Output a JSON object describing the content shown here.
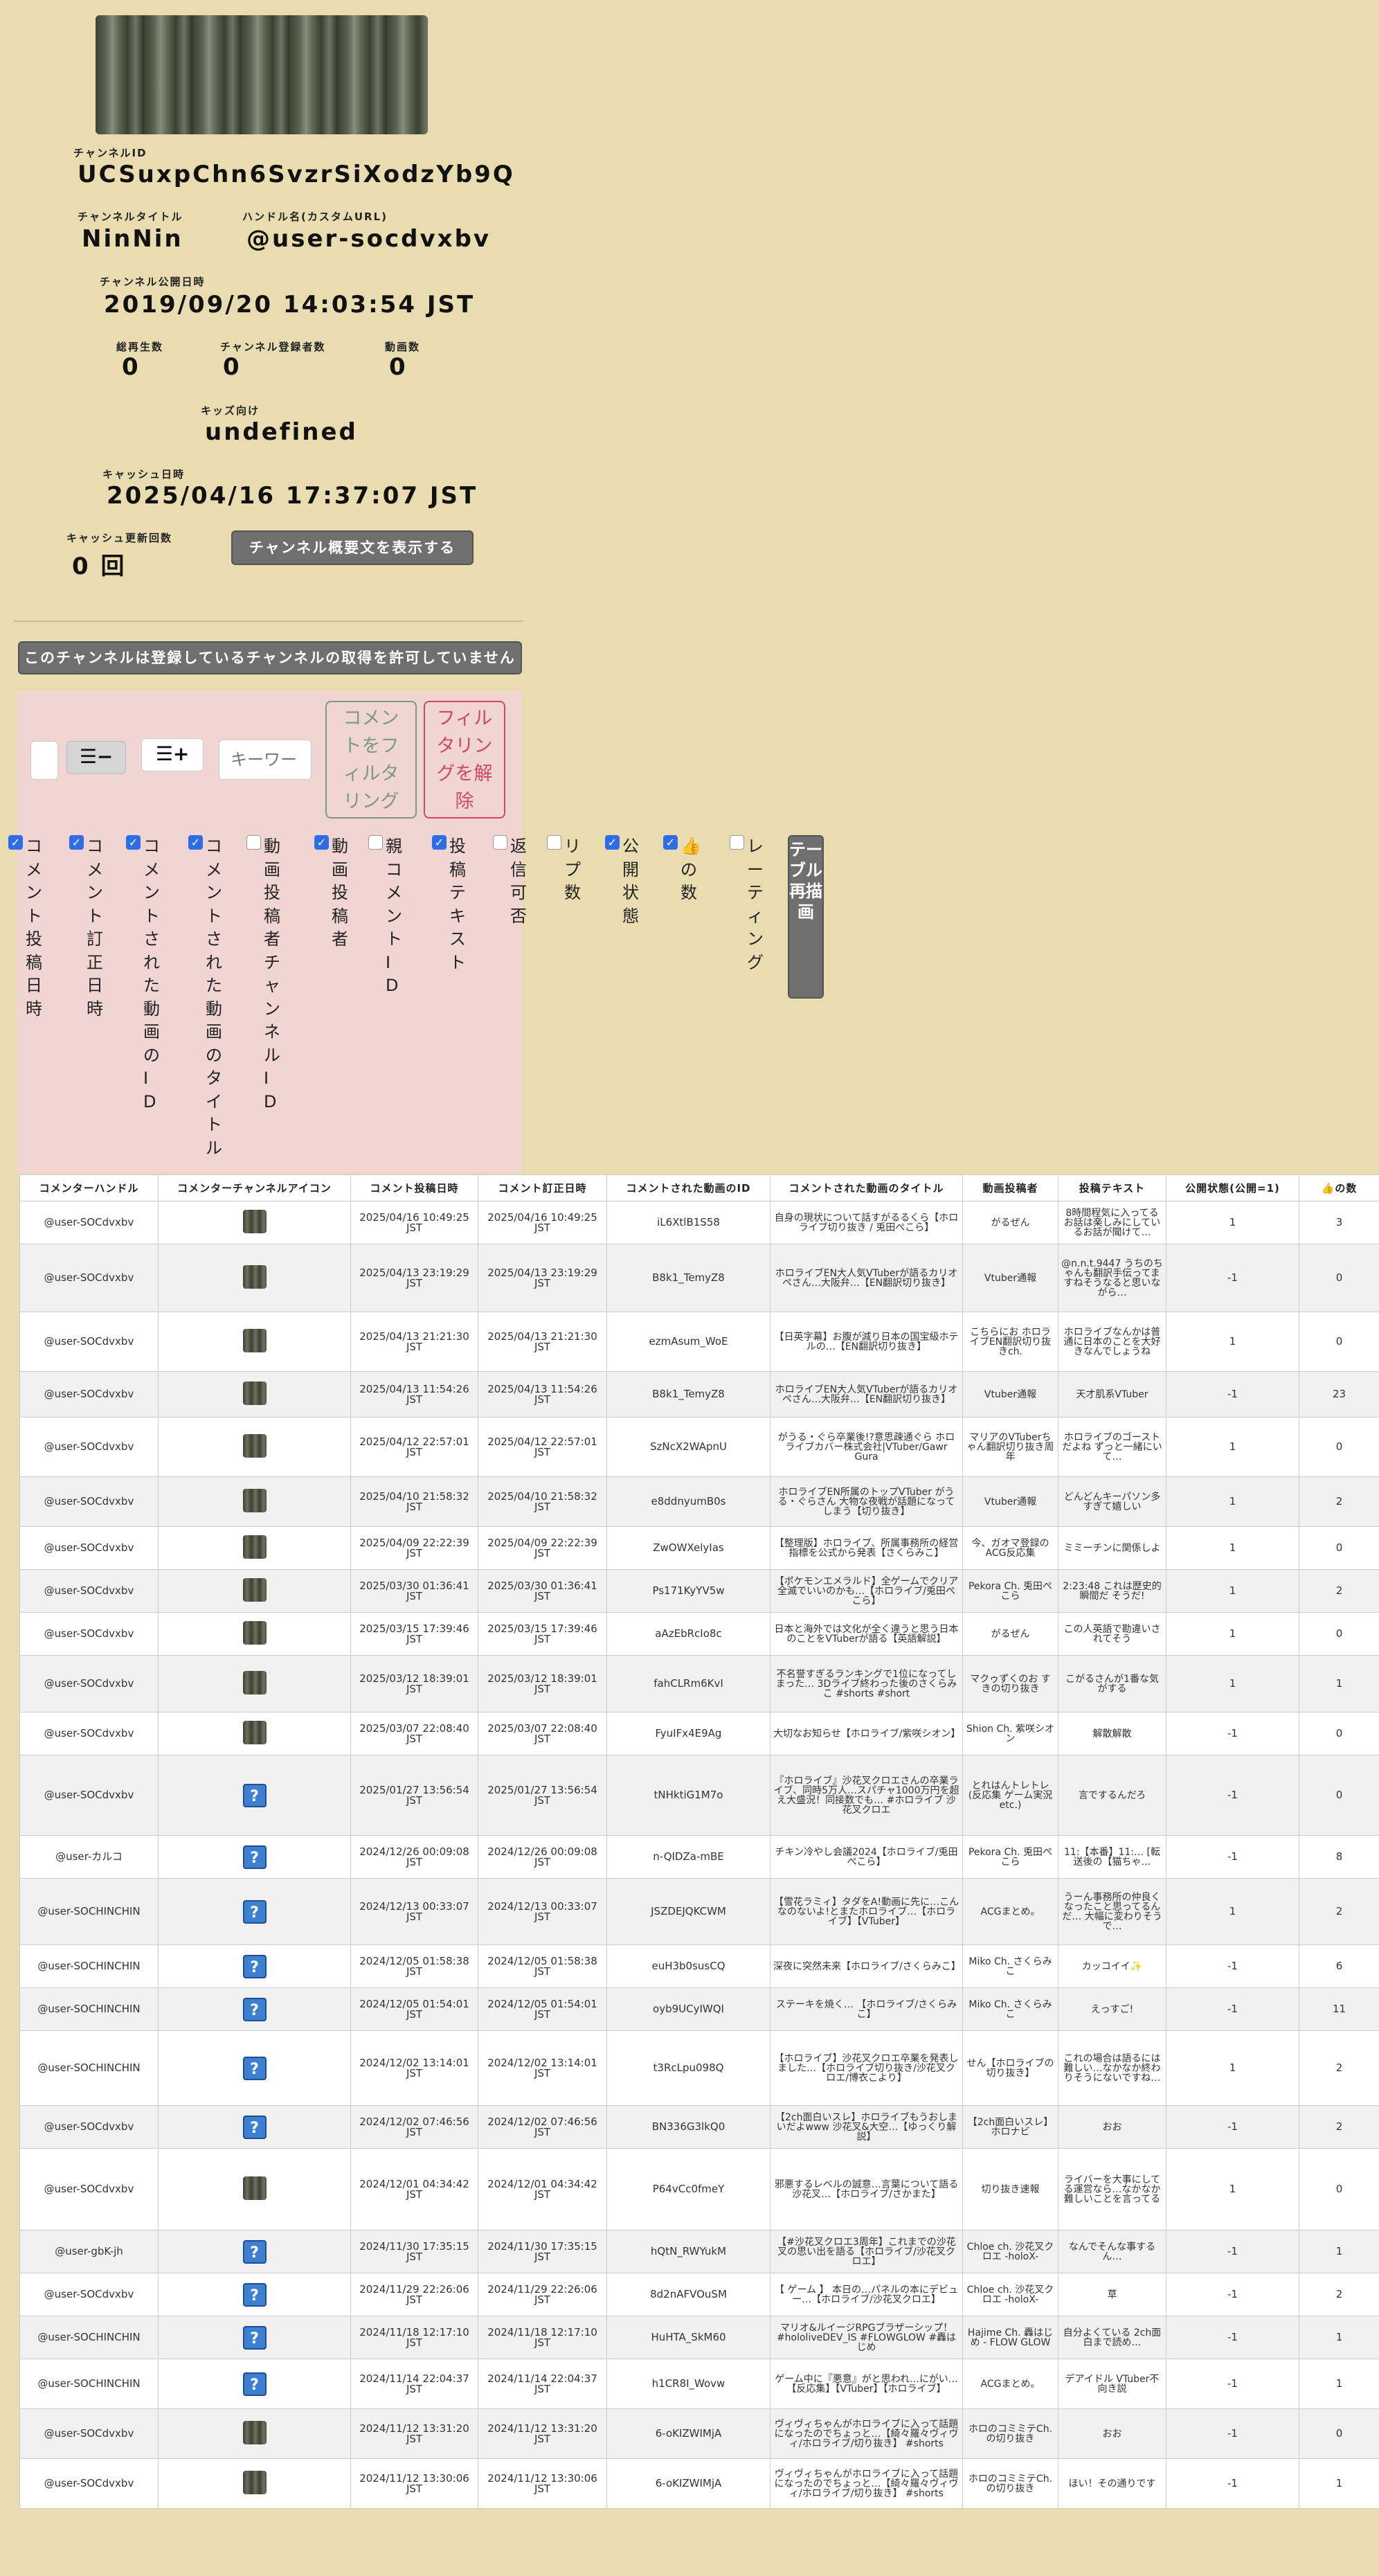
{
  "channel": {
    "id_label": "チャンネルID",
    "id": "UCSuxpChn6SvzrSiXodzYb9Q",
    "title_label": "チャンネルタイトル",
    "title": "NinNin",
    "handle_label": "ハンドル名(カスタムURL)",
    "handle": "@user-socdvxbv",
    "published_label": "チャンネル公開日時",
    "published": "2019/09/20 14:03:54 JST",
    "views_label": "総再生数",
    "views": "0",
    "subs_label": "チャンネル登録者数",
    "subs": "0",
    "videos_label": "動画数",
    "videos": "0",
    "kids_label": "キッズ向け",
    "kids": "undefined",
    "cache_label": "キャッシュ日時",
    "cache": "2025/04/16 17:37:07 JST",
    "refresh_label": "キャッシュ更新回数",
    "refresh": "0 回",
    "desc_button": "チャンネル概要文を表示する",
    "notice": "このチャンネルは登録しているチャンネルの取得を許可していません"
  },
  "filter": {
    "keyword_placeholder": "キーワー",
    "filter_button": "コメントをフィルタリング",
    "clear_button": "フィルタリングを解除",
    "redraw_button": "テーブル再描画",
    "columns": [
      {
        "label": "コメント投稿日時",
        "checked": true
      },
      {
        "label": "コメント訂正日時",
        "checked": true
      },
      {
        "label": "コメントされた動画のID",
        "checked": true
      },
      {
        "label": "コメントされた動画のタイトル",
        "checked": true
      },
      {
        "label": "動画投稿者チャンネルID",
        "checked": false
      },
      {
        "label": "動画投稿者",
        "checked": true
      },
      {
        "label": "親コメントID",
        "checked": false
      },
      {
        "label": "投稿テキスト",
        "checked": true
      },
      {
        "label": "返信可否",
        "checked": false
      },
      {
        "label": "リプ数",
        "checked": false
      },
      {
        "label": "公開状態",
        "checked": true
      },
      {
        "label": "👍の数",
        "checked": true
      },
      {
        "label": "レーティング",
        "checked": false
      }
    ]
  },
  "table": {
    "headers": [
      "コメンターハンドル",
      "コメンターチャンネルアイコン",
      "コメント投稿日時",
      "コメント訂正日時",
      "コメントされた動画のID",
      "コメントされた動画のタイトル",
      "動画投稿者",
      "投稿テキスト",
      "公開状態(公開=1)",
      "👍の数"
    ],
    "rows": [
      {
        "h": "@user-SOCdvxbv",
        "i": "img",
        "p": "2025/04/16 10:49:25 JST",
        "u": "2025/04/16 10:49:25 JST",
        "vid": "iL6XtlB1S58",
        "title": "自身の現状について話すがるるくら【ホロライブ切り抜き / 兎田ぺこら】",
        "up": "がるぜん",
        "text": "8時間程気に入ってるお話は楽しみにしているお話が聞けて…",
        "pub": "1",
        "likes": "3"
      },
      {
        "h": "@user-SOCdvxbv",
        "i": "img",
        "p": "2025/04/13 23:19:29 JST",
        "u": "2025/04/13 23:19:29 JST",
        "vid": "B8k1_TemyZ8",
        "title": "ホロライブEN大人気VTuberが語るカリオペさん…大阪弁…【EN翻訳切り抜き】",
        "up": "Vtuber通報",
        "text": "@n.n.t.9447 うちのちゃんも翻訳手伝ってますねそうなると思いながら…",
        "pub": "-1",
        "likes": "0"
      },
      {
        "h": "@user-SOCdvxbv",
        "i": "img",
        "p": "2025/04/13 21:21:30 JST",
        "u": "2025/04/13 21:21:30 JST",
        "vid": "ezmAsum_WoE",
        "title": "【日英字幕】お腹が減り日本の国宝級ホテルの…【EN翻訳切り抜き】",
        "up": "こちらにお ホロライブEN翻訳切り抜きch.",
        "text": "ホロライブなんかは普通に日本のことを大好きなんでしょうね",
        "pub": "1",
        "likes": "0"
      },
      {
        "h": "@user-SOCdvxbv",
        "i": "img",
        "p": "2025/04/13 11:54:26 JST",
        "u": "2025/04/13 11:54:26 JST",
        "vid": "B8k1_TemyZ8",
        "title": "ホロライブEN大人気VTuberが語るカリオペさん…大阪弁…【EN翻訳切り抜き】",
        "up": "Vtuber通報",
        "text": "天才肌系VTuber",
        "pub": "-1",
        "likes": "23"
      },
      {
        "h": "@user-SOCdvxbv",
        "i": "img",
        "p": "2025/04/12 22:57:01 JST",
        "u": "2025/04/12 22:57:01 JST",
        "vid": "SzNcX2WApnU",
        "title": "がうる・ぐら卒業後!?意思疎通ぐら ホロライブカバー株式会社|VTuber/Gawr Gura",
        "up": "マリアのVTuberちゃん翻訳切り抜き周年",
        "text": "ホロライブのゴーストだよね ずっと一緒にいて…",
        "pub": "1",
        "likes": "0"
      },
      {
        "h": "@user-SOCdvxbv",
        "i": "img",
        "p": "2025/04/10 21:58:32 JST",
        "u": "2025/04/10 21:58:32 JST",
        "vid": "e8ddnyumB0s",
        "title": "ホロライブEN所属のトップVTuber がうる・ぐらさん 大物な夜戦が話題になってしまう【切り抜き】",
        "up": "Vtuber通報",
        "text": "どんどんキーパソン多すぎて嬉しい",
        "pub": "1",
        "likes": "2"
      },
      {
        "h": "@user-SOCdvxbv",
        "i": "img",
        "p": "2025/04/09 22:22:39 JST",
        "u": "2025/04/09 22:22:39 JST",
        "vid": "ZwOWXelyIas",
        "title": "【整理版】ホロライブ、所属事務所の経営指標を公式から発表【さくらみこ】",
        "up": "今、ガオマ登録のACG反応集",
        "text": "ミミーチンに関係しよ",
        "pub": "1",
        "likes": "0"
      },
      {
        "h": "@user-SOCdvxbv",
        "i": "img",
        "p": "2025/03/30 01:36:41 JST",
        "u": "2025/03/30 01:36:41 JST",
        "vid": "Ps171KyYV5w",
        "title": "【ポケモンエメラルド】全ゲームでクリア全滅でいいのかも…【ホロライブ/兎田ぺこら】",
        "up": "Pekora Ch. 兎田ぺこら",
        "text": "2:23:48 これは歴史的瞬間だ そうだ!",
        "pub": "1",
        "likes": "2"
      },
      {
        "h": "@user-SOCdvxbv",
        "i": "img",
        "p": "2025/03/15 17:39:46 JST",
        "u": "2025/03/15 17:39:46 JST",
        "vid": "aAzEbRcIo8c",
        "title": "日本と海外では文化が全く違うと思う日本のことをVTuberが語る【英語解説】",
        "up": "がるぜん",
        "text": "この人英語で勘違いされてそう",
        "pub": "1",
        "likes": "0"
      },
      {
        "h": "@user-SOCdvxbv",
        "i": "img",
        "p": "2025/03/12 18:39:01 JST",
        "u": "2025/03/12 18:39:01 JST",
        "vid": "fahCLRm6KvI",
        "title": "不名誉すぎるランキングで1位になってしまった… 3Dライブ終わった後のさくらみこ #shorts #short",
        "up": "マクゥずくのお すきの切り抜き",
        "text": "こがるさんが1番な気がする",
        "pub": "1",
        "likes": "1"
      },
      {
        "h": "@user-SOCdvxbv",
        "i": "img",
        "p": "2025/03/07 22:08:40 JST",
        "u": "2025/03/07 22:08:40 JST",
        "vid": "FyuIFx4E9Ag",
        "title": "大切なお知らせ【ホロライブ/紫咲シオン】",
        "up": "Shion Ch. 紫咲シオン",
        "text": "解散解散",
        "pub": "-1",
        "likes": "0"
      },
      {
        "h": "@user-SOCdvxbv",
        "i": "q",
        "p": "2025/01/27 13:56:54 JST",
        "u": "2025/01/27 13:56:54 JST",
        "vid": "tNHktiG1M7o",
        "title": "『ホロライブ』沙花叉クロエさんの卒業ライブ、同時5万人…スパチャ1000万円を超え大盛況！同接数でも… #ホロライブ 沙花叉クロエ",
        "up": "とれはんトレトレ(反応集 ゲーム実況 etc.)",
        "text": "言でするんだろ",
        "pub": "-1",
        "likes": "0"
      },
      {
        "h": "@user-カルコ",
        "i": "q",
        "p": "2024/12/26 00:09:08 JST",
        "u": "2024/12/26 00:09:08 JST",
        "vid": "n-QIDZa-mBE",
        "title": "チキン冷やし会議2024【ホロライブ/兎田ぺこら】",
        "up": "Pekora Ch. 兎田ぺこら",
        "text": "11:【本番】11:… [転送後の【猫ちゃ…",
        "pub": "-1",
        "likes": "8"
      },
      {
        "h": "@user-SOCHINCHIN",
        "i": "q",
        "p": "2024/12/13 00:33:07 JST",
        "u": "2024/12/13 00:33:07 JST",
        "vid": "JSZDEJQKCWM",
        "title": "【雪花ラミィ】タダをA!動画に先に…こんなのないよ!とまたホロライブ…【ホロライブ】【VTuber】",
        "up": "ACGまとめ。",
        "text": "うーん事務所の仲良くなったこと思ってるんだ… 大幅に変わりそうで…",
        "pub": "1",
        "likes": "2"
      },
      {
        "h": "@user-SOCHINCHIN",
        "i": "q",
        "p": "2024/12/05 01:58:38 JST",
        "u": "2024/12/05 01:58:38 JST",
        "vid": "euH3b0susCQ",
        "title": "深夜に突然未来【ホロライブ/さくらみこ】",
        "up": "Miko Ch. さくらみこ",
        "text": "カッコイイ✨",
        "pub": "-1",
        "likes": "6"
      },
      {
        "h": "@user-SOCHINCHIN",
        "i": "q",
        "p": "2024/12/05 01:54:01 JST",
        "u": "2024/12/05 01:54:01 JST",
        "vid": "oyb9UCyIWQI",
        "title": "ステーキを焼く… 【ホロライブ/さくらみこ】",
        "up": "Miko Ch. さくらみこ",
        "text": "えっすご!",
        "pub": "-1",
        "likes": "11"
      },
      {
        "h": "@user-SOCHINCHIN",
        "i": "q",
        "p": "2024/12/02 13:14:01 JST",
        "u": "2024/12/02 13:14:01 JST",
        "vid": "t3RcLpu098Q",
        "title": "【ホロライブ】沙花叉クロエ卒業を発表しました…【ホロライブ切り抜き/沙花叉クロエ/博衣こより】",
        "up": "せん【ホロライブの切り抜き】",
        "text": "これの場合は語るには難しい…なかなか終わりそうにないですね…",
        "pub": "1",
        "likes": "2"
      },
      {
        "h": "@user-SOCdvxbv",
        "i": "q",
        "p": "2024/12/02 07:46:56 JST",
        "u": "2024/12/02 07:46:56 JST",
        "vid": "BN336G3lkQ0",
        "title": "【2ch面白いスレ】ホロライブもうおしまいだよwww 沙花叉&大空…【ゆっくり解説】",
        "up": "【2ch面白いスレ】ホロナビ",
        "text": "おお",
        "pub": "-1",
        "likes": "2"
      },
      {
        "h": "@user-SOCdvxbv",
        "i": "img",
        "p": "2024/12/01 04:34:42 JST",
        "u": "2024/12/01 04:34:42 JST",
        "vid": "P64vCc0fmeY",
        "title": "邪悪するレベルの誠意…言葉について語る沙花叉…【ホロライブ/さかまた】",
        "up": "切り抜き速報",
        "text": "ライバーを大事にしてる運営なら…なかなか難しいことを言ってる",
        "pub": "1",
        "likes": "0"
      },
      {
        "h": "@user-gbK-jh",
        "i": "q",
        "p": "2024/11/30 17:35:15 JST",
        "u": "2024/11/30 17:35:15 JST",
        "vid": "hQtN_RWYukM",
        "title": "【#沙花叉クロエ3周年】これまでの沙花叉の思い出を語る【ホロライブ/沙花叉クロエ】",
        "up": "Chloe ch. 沙花叉クロエ -holoX-",
        "text": "なんでそんな事するん…",
        "pub": "-1",
        "likes": "1"
      },
      {
        "h": "@user-SOCdvxbv",
        "i": "q",
        "p": "2024/11/29 22:26:06 JST",
        "u": "2024/11/29 22:26:06 JST",
        "vid": "8d2nAFVOuSM",
        "title": "【 ゲーム 】 本日の…パネルの本にデビュー…【ホロライブ/沙花叉クロエ】",
        "up": "Chloe ch. 沙花叉クロエ -holoX-",
        "text": "草",
        "pub": "-1",
        "likes": "2"
      },
      {
        "h": "@user-SOCHINCHIN",
        "i": "q",
        "p": "2024/11/18 12:17:10 JST",
        "u": "2024/11/18 12:17:10 JST",
        "vid": "HuHTA_SkM60",
        "title": "マリオ&ルイージRPGブラザーシップ！ #hololiveDEV_IS #FLOWGLOW #轟はじめ",
        "up": "Hajime Ch. 轟はじめ - FLOW GLOW",
        "text": "自分よくている 2ch面白まで読め…",
        "pub": "-1",
        "likes": "1"
      },
      {
        "h": "@user-SOCHINCHIN",
        "i": "q",
        "p": "2024/11/14 22:04:37 JST",
        "u": "2024/11/14 22:04:37 JST",
        "vid": "h1CR8I_Wovw",
        "title": "ゲーム中に『悪意』がと思われ…にがい…【反応集】【VTuber】【ホロライブ】",
        "up": "ACGまとめ。",
        "text": "デアイドル VTuber不向き説",
        "pub": "-1",
        "likes": "1"
      },
      {
        "h": "@user-SOCdvxbv",
        "i": "img",
        "p": "2024/11/12 13:31:20 JST",
        "u": "2024/11/12 13:31:20 JST",
        "vid": "6-oKIZWIMjA",
        "title": "ヴィヴィちゃんがホロライブに入って話題になったのでちょっと…【綺々羅々ヴィヴィ/ホロライブ/切り抜き】 #shorts",
        "up": "ホロのコミミテCh.の切り抜き",
        "text": "おお",
        "pub": "-1",
        "likes": "0"
      },
      {
        "h": "@user-SOCdvxbv",
        "i": "img",
        "p": "2024/11/12 13:30:06 JST",
        "u": "2024/11/12 13:30:06 JST",
        "vid": "6-oKIZWIMjA",
        "title": "ヴィヴィちゃんがホロライブに入って話題になったのでちょっと…【綺々羅々ヴィヴィ/ホロライブ/切り抜き】 #shorts",
        "up": "ホロのコミミテCh.の切り抜き",
        "text": "ほい！その通りです",
        "pub": "-1",
        "likes": "1"
      }
    ]
  }
}
